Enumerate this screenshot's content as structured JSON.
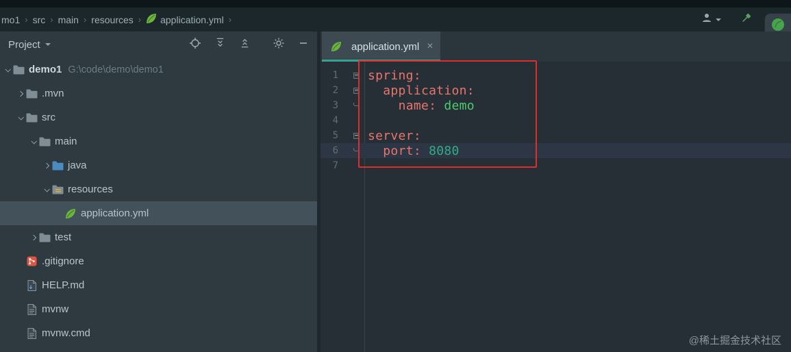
{
  "breadcrumbs": {
    "separator": "›",
    "items": [
      {
        "label": "mo1"
      },
      {
        "label": "src"
      },
      {
        "label": "main"
      },
      {
        "label": "resources"
      },
      {
        "label": "application.yml",
        "icon": "spring"
      }
    ]
  },
  "project_panel": {
    "title": "Project",
    "tree": [
      {
        "label": "demo1",
        "suffix": "G:\\code\\demo\\demo1",
        "level": 0,
        "chevron": "expanded",
        "icon": "folder",
        "bold": true
      },
      {
        "label": ".mvn",
        "level": 1,
        "chevron": "collapsed",
        "icon": "folder"
      },
      {
        "label": "src",
        "level": 1,
        "chevron": "expanded",
        "icon": "folder"
      },
      {
        "label": "main",
        "level": 2,
        "chevron": "expanded",
        "icon": "folder"
      },
      {
        "label": "java",
        "level": 3,
        "chevron": "collapsed",
        "icon": "folder-java"
      },
      {
        "label": "resources",
        "level": 3,
        "chevron": "expanded",
        "icon": "folder-resources"
      },
      {
        "label": "application.yml",
        "level": 4,
        "chevron": "none",
        "icon": "spring",
        "selected": true
      },
      {
        "label": "test",
        "level": 2,
        "chevron": "collapsed",
        "icon": "folder"
      },
      {
        "label": ".gitignore",
        "level": 1,
        "chevron": "none",
        "icon": "git"
      },
      {
        "label": "HELP.md",
        "level": 1,
        "chevron": "none",
        "icon": "md"
      },
      {
        "label": "mvnw",
        "level": 1,
        "chevron": "none",
        "icon": "file"
      },
      {
        "label": "mvnw.cmd",
        "level": 1,
        "chevron": "none",
        "icon": "file"
      }
    ]
  },
  "editor": {
    "tab": {
      "label": "application.yml",
      "close": "×"
    },
    "lines": [
      {
        "n": 1,
        "fold": "open",
        "tokens": [
          [
            "key",
            "spring:"
          ]
        ]
      },
      {
        "n": 2,
        "fold": "open",
        "tokens": [
          [
            "plain",
            "  "
          ],
          [
            "key",
            "application:"
          ]
        ]
      },
      {
        "n": 3,
        "fold": "end",
        "tokens": [
          [
            "plain",
            "    "
          ],
          [
            "key",
            "name:"
          ],
          [
            "plain",
            " "
          ],
          [
            "string",
            "demo"
          ]
        ]
      },
      {
        "n": 4,
        "fold": "none",
        "tokens": []
      },
      {
        "n": 5,
        "fold": "open",
        "tokens": [
          [
            "key",
            "server:"
          ]
        ]
      },
      {
        "n": 6,
        "fold": "end",
        "tokens": [
          [
            "plain",
            "  "
          ],
          [
            "key",
            "port:"
          ],
          [
            "plain",
            " "
          ],
          [
            "number",
            "8080"
          ]
        ],
        "current": true
      },
      {
        "n": 7,
        "fold": "none",
        "tokens": []
      }
    ]
  },
  "watermark": {
    "text": "@稀土掘金技术社区"
  },
  "colors": {
    "accent_teal": "#35a392",
    "spring_green": "#6DB33F",
    "annotation_red": "#df2f2b",
    "key_color": "#e8756d",
    "string_color": "#4ecb71",
    "number_color": "#2fae85",
    "selection_row": "#42515a",
    "current_line": "#2c3645"
  }
}
